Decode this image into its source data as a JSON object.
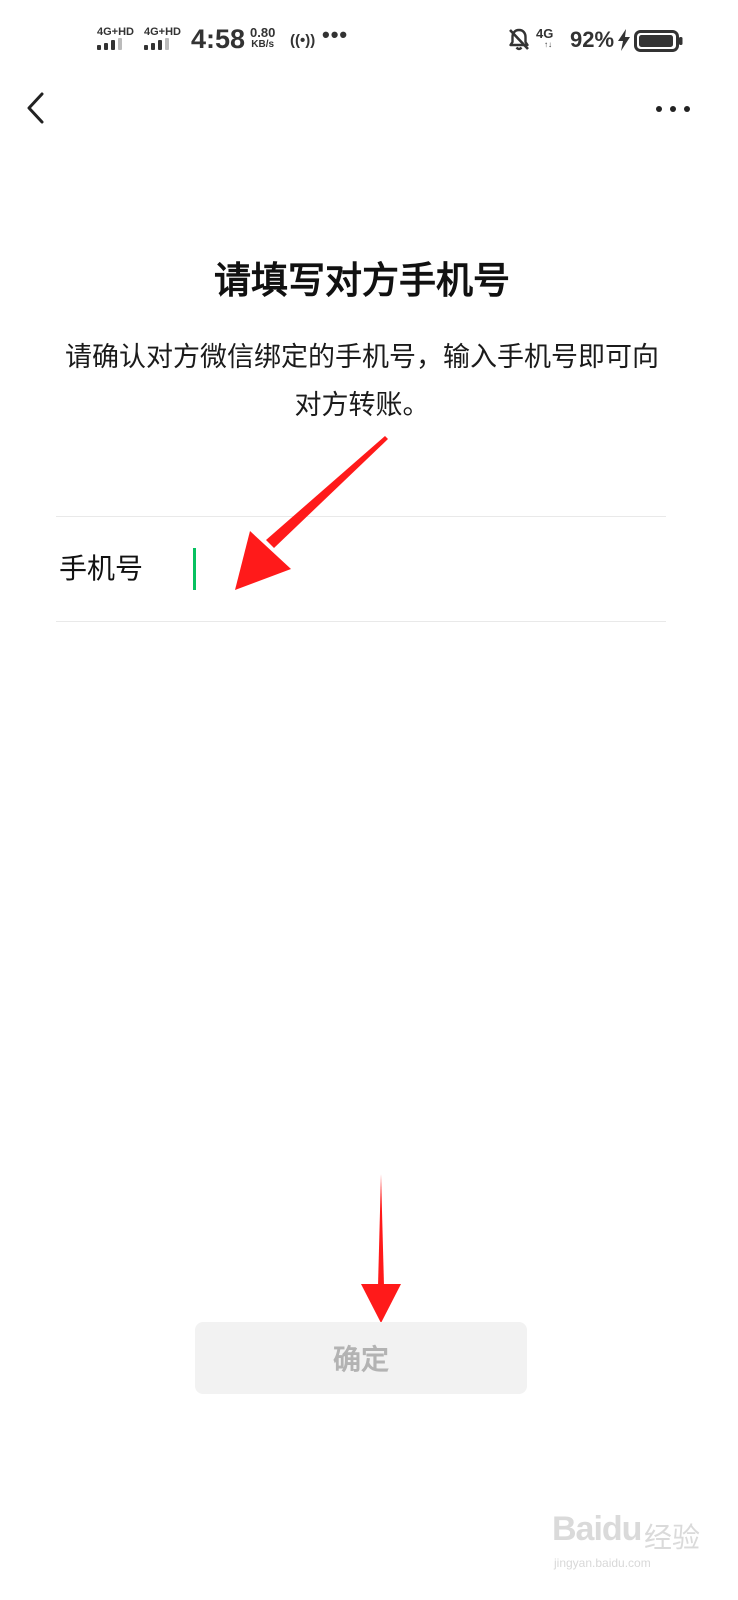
{
  "status_bar": {
    "sim1_label": "4G+HD",
    "sim2_label": "4G+HD",
    "time": "4:58",
    "speed_value": "0.80",
    "speed_unit": "KB/s",
    "hotspot_glyph": "((•))",
    "more_glyph": "•••",
    "mute_icon": "bell-off-icon",
    "network_right": "4G",
    "network_arrows": "↑↓",
    "battery_percent": "92%",
    "charging_icon": "bolt-icon",
    "battery_level": 0.92
  },
  "nav": {
    "back_icon": "chevron-left-icon",
    "more_icon": "more-horizontal-icon"
  },
  "main": {
    "title": "请填写对方手机号",
    "description": "请确认对方微信绑定的手机号，输入手机号即可向对方转账。",
    "phone_label": "手机号",
    "phone_value": "",
    "phone_placeholder": ""
  },
  "confirm_button": {
    "label": "确定"
  },
  "watermark": {
    "logo": "Baidu",
    "suffix": "经验",
    "url": "jingyan.baidu.com"
  },
  "colors": {
    "accent": "#07c160",
    "arrow": "#ff1a1a",
    "button_bg": "#f2f2f2",
    "button_text": "#b3b3b3",
    "divider": "#e9e9e9"
  }
}
